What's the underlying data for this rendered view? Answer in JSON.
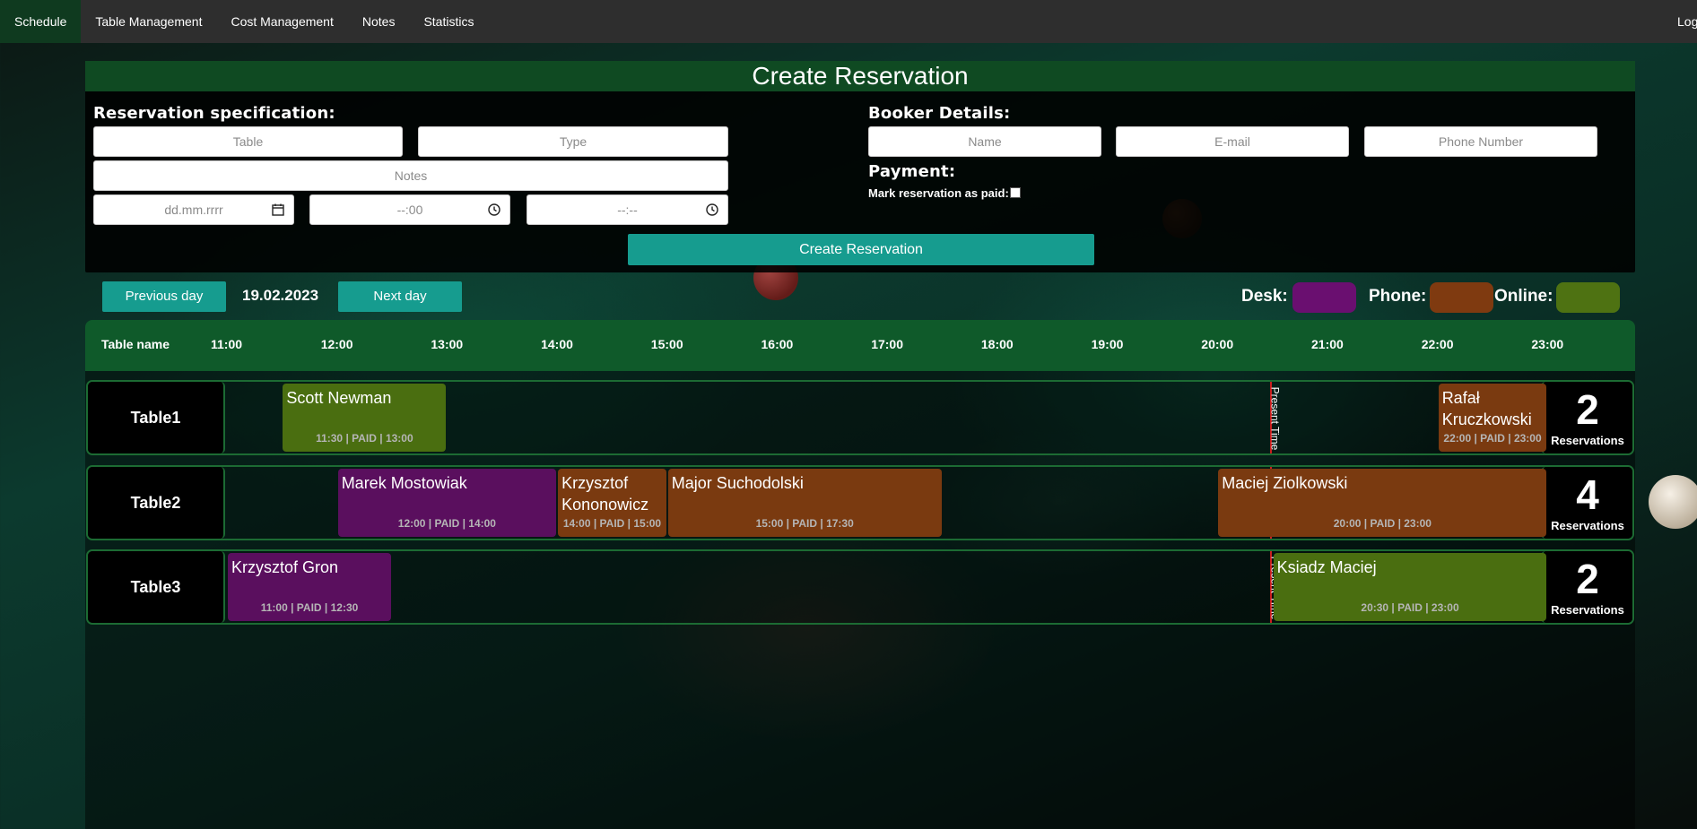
{
  "nav": {
    "items": [
      "Schedule",
      "Table Management",
      "Cost Management",
      "Notes",
      "Statistics"
    ],
    "active": "Schedule",
    "logout_label": "Logout"
  },
  "create_form": {
    "title": "Create Reservation",
    "spec_title": "Reservation specification:",
    "booker_title": "Booker Details:",
    "payment_title": "Payment:",
    "mark_paid_label": "Mark reservation as paid:",
    "placeholders": {
      "table": "Table",
      "type": "Type",
      "notes": "Notes",
      "date": "dd.mm.rrrr",
      "time_from": "--:00",
      "time_to": "--:--",
      "name": "Name",
      "email": "E-mail",
      "phone": "Phone Number"
    },
    "submit_label": "Create Reservation"
  },
  "day_nav": {
    "prev_label": "Previous day",
    "next_label": "Next day",
    "date": "19.02.2023"
  },
  "legend": {
    "desk": {
      "label": "Desk:",
      "color": "#5a0f5e"
    },
    "phone": {
      "label": "Phone:",
      "color": "#7a3a10"
    },
    "online": {
      "label": "Online:",
      "color": "#4a6e10"
    }
  },
  "schedule": {
    "header_label": "Table name",
    "hours": [
      "11:00",
      "12:00",
      "13:00",
      "14:00",
      "15:00",
      "16:00",
      "17:00",
      "18:00",
      "19:00",
      "20:00",
      "21:00",
      "22:00",
      "23:00"
    ],
    "present_label": "Present Time",
    "reservations_label": "Reservations",
    "tables": [
      {
        "name": "Table1",
        "count": "2",
        "reservations": [
          {
            "who": "Scott Newman",
            "meta": "11:30 | PAID | 13:00",
            "source": "online",
            "start": 11.5,
            "end": 13.0
          },
          {
            "who": "Rafał Kruczkowski",
            "meta": "22:00 | PAID | 23:00",
            "source": "phone",
            "start": 22.0,
            "end": 23.0
          }
        ]
      },
      {
        "name": "Table2",
        "count": "4",
        "reservations": [
          {
            "who": "Marek Mostowiak",
            "meta": "12:00 | PAID | 14:00",
            "source": "desk",
            "start": 12.0,
            "end": 14.0
          },
          {
            "who": "Krzysztof Kononowicz",
            "meta": "14:00 | PAID | 15:00",
            "source": "phone",
            "start": 14.0,
            "end": 15.0
          },
          {
            "who": "Major Suchodolski",
            "meta": "15:00 | PAID | 17:30",
            "source": "phone",
            "start": 15.0,
            "end": 17.5
          },
          {
            "who": "Maciej Ziolkowski",
            "meta": "20:00 | PAID | 23:00",
            "source": "phone",
            "start": 20.0,
            "end": 23.0
          }
        ]
      },
      {
        "name": "Table3",
        "count": "2",
        "reservations": [
          {
            "who": "Krzysztof Gron",
            "meta": "11:00 | PAID | 12:30",
            "source": "desk",
            "start": 11.0,
            "end": 12.5
          },
          {
            "who": "Ksiadz Maciej",
            "meta": "20:30 | PAID | 23:00",
            "source": "online",
            "start": 20.5,
            "end": 23.0
          }
        ]
      }
    ]
  }
}
